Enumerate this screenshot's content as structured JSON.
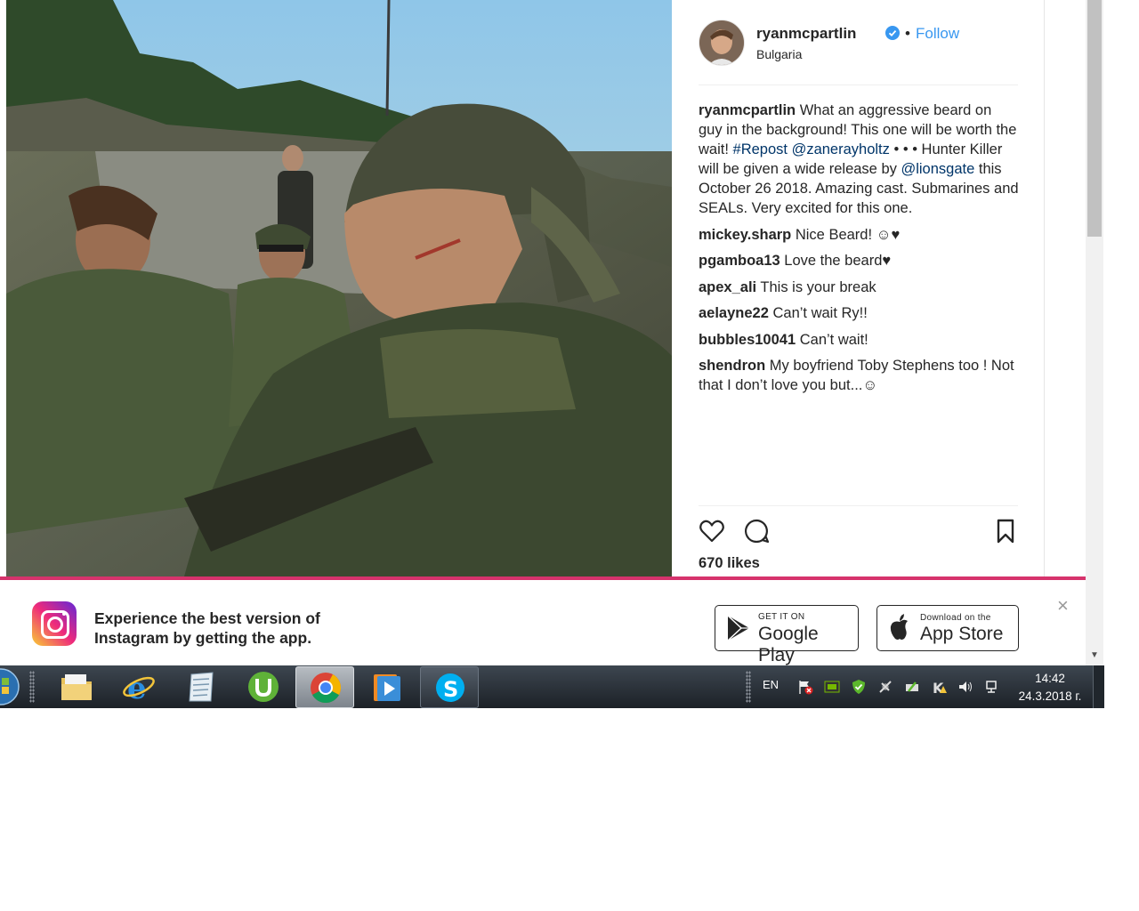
{
  "post": {
    "username": "ryanmcpartlin",
    "follow_label": "Follow",
    "dot": "•",
    "location": "Bulgaria",
    "caption": {
      "user": "ryanmcpartlin",
      "text1": " What an aggressive beard on guy in the background! This one will be worth the wait! ",
      "tag": "#Repost",
      "space1": " ",
      "mention1": "@zanerayholtz",
      "text2": " • • • Hunter Killer will be given a wide release by ",
      "mention2": "@lionsgate",
      "text3": " this October 26 2018. Amazing cast. Submarines and SEALs. Very excited for this one."
    },
    "comments": [
      {
        "user": "mickey.sharp",
        "text": " Nice Beard! ☺♥"
      },
      {
        "user": "pgamboa13",
        "text": " Love the beard♥"
      },
      {
        "user": "apex_ali",
        "text": " This is your break"
      },
      {
        "user": "aelayne22",
        "text": " Can’t wait Ry!!"
      },
      {
        "user": "bubbles10041",
        "text": " Can’t wait!"
      },
      {
        "user": "shendron",
        "text": " My boyfriend Toby Stephens too ! Not that I don’t love you but...☺"
      }
    ],
    "likes": "670 likes",
    "icons": [
      "heart-icon",
      "comment-icon",
      "bookmark-icon"
    ]
  },
  "banner": {
    "line1": "Experience the best version of",
    "line2": "Instagram by getting the app.",
    "google_small": "GET IT ON",
    "google_big": "Google Play",
    "apple_small": "Download on the",
    "apple_big": "App Store",
    "close": "×"
  },
  "taskbar": {
    "language": "EN",
    "time": "14:42",
    "date": "24.3.2018 г.",
    "apps": [
      "start-orb",
      "file-explorer",
      "internet-explorer",
      "notepad",
      "utorrent",
      "chrome",
      "media-player",
      "skype"
    ]
  },
  "colors": {
    "link": "#003569",
    "follow": "#3897f0",
    "banner_accent": "#d6336c"
  }
}
